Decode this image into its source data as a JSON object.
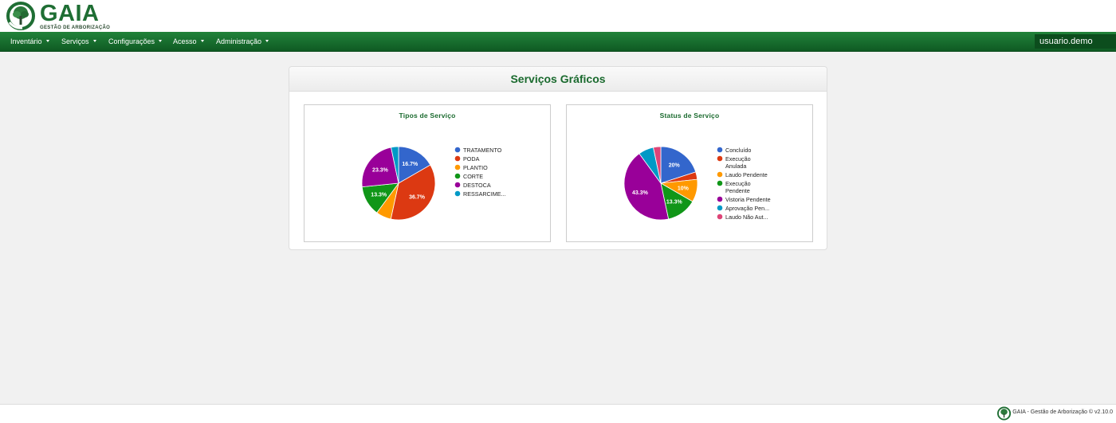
{
  "brand": {
    "name": "GAIA",
    "subtitle": "GESTÃO DE ARBORIZAÇÃO",
    "brand_color": "#1f6e34"
  },
  "nav": {
    "items": [
      {
        "label": "Inventário"
      },
      {
        "label": "Serviços"
      },
      {
        "label": "Configurações"
      },
      {
        "label": "Acesso"
      },
      {
        "label": "Administração"
      }
    ],
    "user": "usuario.demo",
    "bar_color": "#1a7232"
  },
  "panel": {
    "title": "Serviços Gráficos"
  },
  "chart_data": [
    {
      "type": "pie",
      "title": "Tipos de Serviço",
      "legend_position": "right",
      "slices": [
        {
          "label": "TRATAMENTO",
          "value": 16.7,
          "color": "#3366cc",
          "data_label": "16.7%"
        },
        {
          "label": "PODA",
          "value": 36.7,
          "color": "#dc3912",
          "data_label": "36.7%"
        },
        {
          "label": "PLANTIO",
          "value": 6.7,
          "color": "#ff9900",
          "data_label": ""
        },
        {
          "label": "CORTE",
          "value": 13.3,
          "color": "#109618",
          "data_label": "13.3%"
        },
        {
          "label": "DESTOCA",
          "value": 23.3,
          "color": "#990099",
          "data_label": "23.3%"
        },
        {
          "label": "RESSARCIME...",
          "value": 3.3,
          "color": "#0099c6",
          "data_label": ""
        }
      ]
    },
    {
      "type": "pie",
      "title": "Status de Serviço",
      "legend_position": "right",
      "slices": [
        {
          "label": "Concluído",
          "value": 20,
          "color": "#3366cc",
          "data_label": "20%"
        },
        {
          "label": "Execução Anulada",
          "value": 3.3,
          "color": "#dc3912",
          "data_label": ""
        },
        {
          "label": "Laudo Pendente",
          "value": 10,
          "color": "#ff9900",
          "data_label": "10%"
        },
        {
          "label": "Execução Pendente",
          "value": 13.3,
          "color": "#109618",
          "data_label": "13.3%"
        },
        {
          "label": "Vistoria Pendente",
          "value": 43.3,
          "color": "#990099",
          "data_label": "43.3%"
        },
        {
          "label": "Aprovação Pen...",
          "value": 6.7,
          "color": "#0099c6",
          "data_label": ""
        },
        {
          "label": "Laudo Não Aut...",
          "value": 3.3,
          "color": "#dd4477",
          "data_label": ""
        }
      ]
    }
  ],
  "footer": {
    "text": "GAIA - Gestão de Arborização © v2.10.0"
  }
}
